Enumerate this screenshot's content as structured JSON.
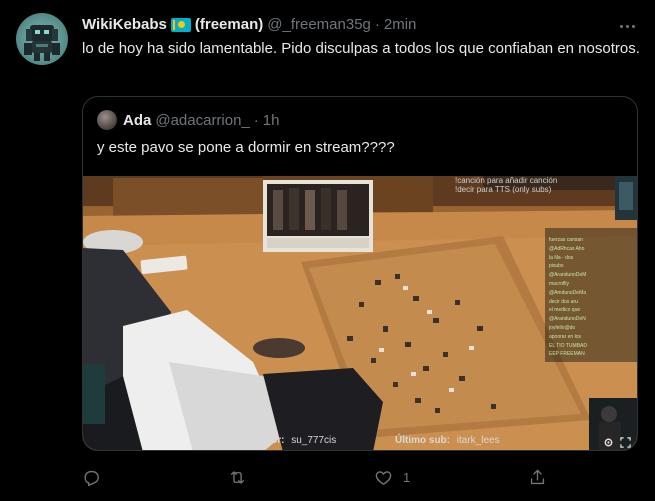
{
  "tweet": {
    "display_name": "WikiKebabs",
    "flag_icon": "kazakhstan-flag-icon",
    "name_suffix": "(freeman)",
    "handle": "@_freeman35g",
    "separator": "·",
    "time": "2min",
    "text": "lo de hoy ha sido lamentable. Pido disculpas a todos los que confiaban en nosotros."
  },
  "quote": {
    "display_name": "Ada",
    "handle": "@adacarrion_",
    "separator": "·",
    "time": "1h",
    "text": "y este pavo se pone a dormir en stream????",
    "media": {
      "overlay_top_line1": "!canción para añadir canción",
      "overlay_top_line2": "!decir para TTS (only subs)",
      "last_follower_label": "Último seguidor:",
      "last_follower_value": "su_777cis",
      "last_sub_label": "Último sub:",
      "last_sub_value": "itark_lees",
      "chat_lines": [
        "fuerzas cansan",
        "@AdRhcas Aho",
        "la fila - dos",
        "pisubs",
        "@ArandunoDeM",
        "macroflly",
        "@AmdunoDeMa",
        "decir dos aru",
        "el medico que",
        "@ArandunoDeN",
        "joyfello@do",
        "apoorar en los",
        "EL TIO TUMBAD",
        "EEP FREEMAN"
      ]
    }
  },
  "actions": {
    "reply_icon": "reply-icon",
    "retweet_icon": "retweet-icon",
    "like_icon": "like-icon",
    "like_count": "1",
    "share_icon": "share-icon"
  },
  "colors": {
    "background": "#000000",
    "text_primary": "#e7e9ea",
    "text_secondary": "#71767b",
    "border": "#2f3336",
    "flag_blue": "#00afca",
    "flag_gold": "#fec50c"
  }
}
